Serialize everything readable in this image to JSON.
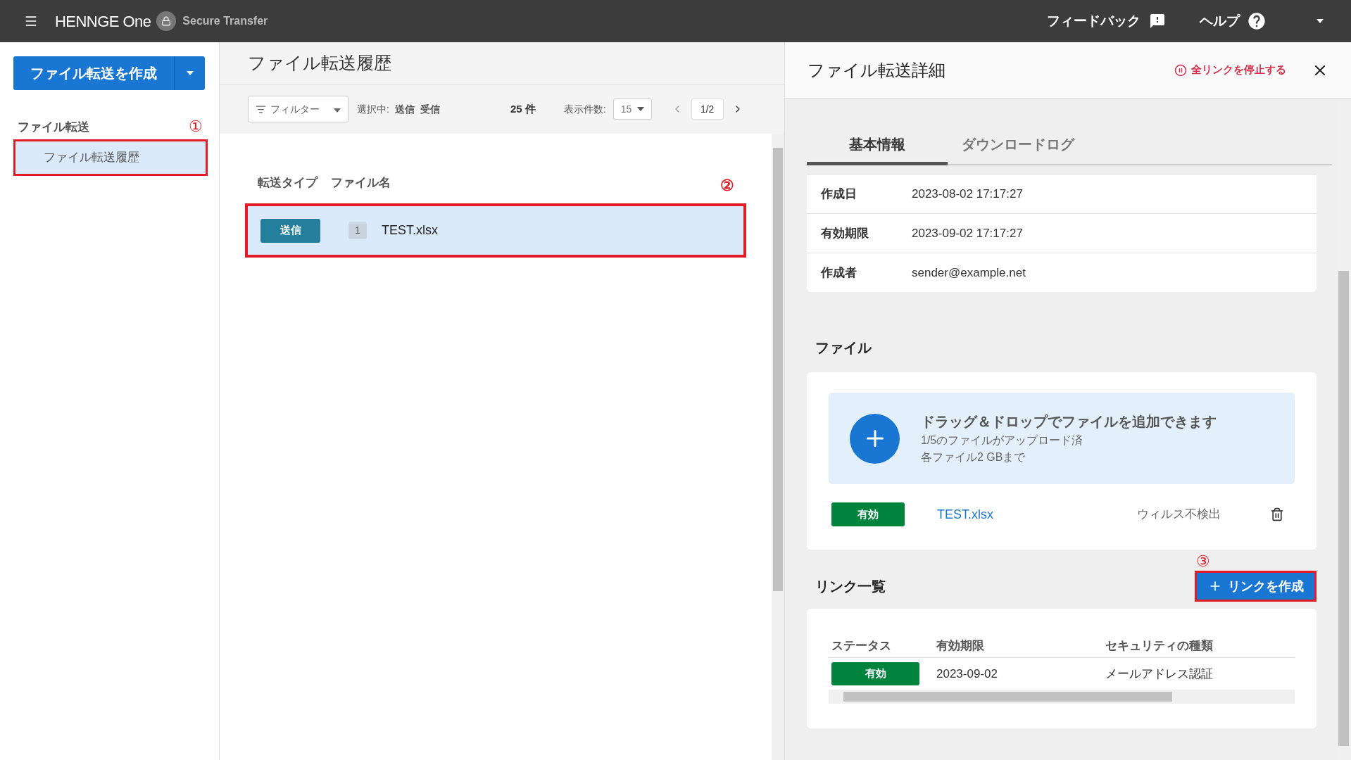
{
  "header": {
    "logo": "HENNGE One",
    "product": "Secure Transfer",
    "feedback": "フィードバック",
    "help": "ヘルプ"
  },
  "sidebar": {
    "create_button": "ファイル転送を作成",
    "section": "ファイル転送",
    "section_callout": "①",
    "items": [
      {
        "label": "ファイル転送履歴",
        "selected": true,
        "highlighted": true
      }
    ]
  },
  "list": {
    "title": "ファイル転送履歴",
    "filter": "フィルター",
    "selected_label": "選択中:",
    "selected_types": [
      "送信",
      "受信"
    ],
    "count": "25 件",
    "per_page_label": "表示件数:",
    "per_page": "15",
    "page": "1/2",
    "columns": [
      "転送タイプ",
      "ファイル名"
    ],
    "callout": "②",
    "rows": [
      {
        "type": "送信",
        "file_count": "1",
        "name": "TEST.xlsx",
        "selected": true,
        "highlighted": true
      }
    ]
  },
  "detail": {
    "title": "ファイル転送詳細",
    "stop_all": "全リンクを停止する",
    "tabs": [
      {
        "label": "基本情報",
        "selected": true
      },
      {
        "label": "ダウンロードログ",
        "selected": false
      }
    ],
    "info": [
      {
        "label": "作成日",
        "value": "2023-08-02 17:17:27"
      },
      {
        "label": "有効期限",
        "value": "2023-09-02 17:17:27"
      },
      {
        "label": "作成者",
        "value": "sender@example.net"
      }
    ],
    "files_heading": "ファイル",
    "dropzone": {
      "title": "ドラッグ＆ドロップでファイルを追加できます",
      "lines": [
        "1/5のファイルがアップロード済",
        "各ファイル2 GBまで"
      ]
    },
    "files": [
      {
        "status": "有効",
        "name": "TEST.xlsx",
        "scan": "ウィルス不検出"
      }
    ],
    "links_heading": "リンク一覧",
    "create_link": "リンクを作成",
    "create_link_callout": "③",
    "create_link_highlighted": true,
    "link_columns": [
      "ステータス",
      "有効期限",
      "セキュリティの種類"
    ],
    "links": [
      {
        "status": "有効",
        "expires": "2023-09-02",
        "security": "メールアドレス認証"
      }
    ]
  }
}
